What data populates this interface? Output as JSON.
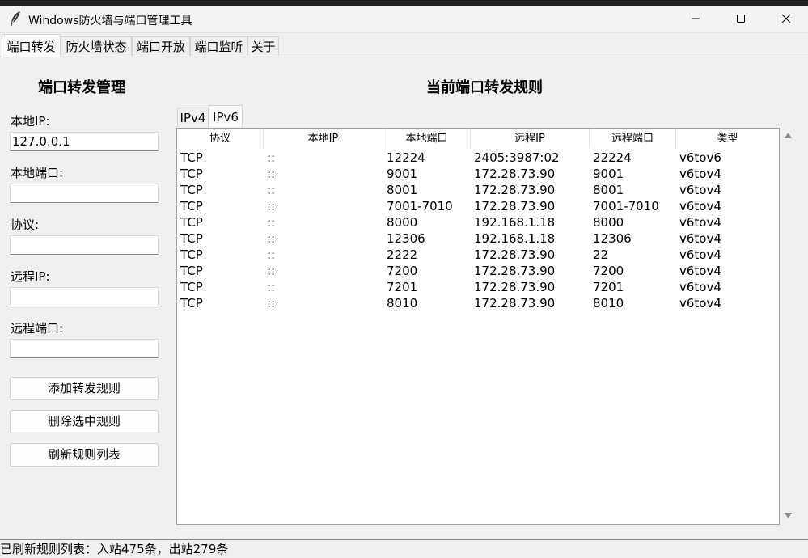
{
  "window": {
    "title": "Windows防火墙与端口管理工具"
  },
  "tabs": [
    "端口转发",
    "防火墙状态",
    "端口开放",
    "端口监听",
    "关于"
  ],
  "left": {
    "title": "端口转发管理",
    "fields": [
      {
        "label": "本地IP:",
        "value": "127.0.0.1"
      },
      {
        "label": "本地端口:",
        "value": ""
      },
      {
        "label": "协议:",
        "value": ""
      },
      {
        "label": "远程IP:",
        "value": ""
      },
      {
        "label": "远程端口:",
        "value": ""
      }
    ],
    "buttons": [
      "添加转发规则",
      "删除选中规则",
      "刷新规则列表"
    ]
  },
  "right": {
    "title": "当前端口转发规则",
    "subtabs": [
      "IPv4",
      "IPv6"
    ],
    "columns": [
      "协议",
      "本地IP",
      "本地端口",
      "远程IP",
      "远程端口",
      "类型"
    ],
    "rows": [
      [
        "TCP",
        "::",
        "12224",
        "2405:3987:02",
        "22224",
        "v6tov6"
      ],
      [
        "TCP",
        "::",
        "9001",
        "172.28.73.90",
        "9001",
        "v6tov4"
      ],
      [
        "TCP",
        "::",
        "8001",
        "172.28.73.90",
        "8001",
        "v6tov4"
      ],
      [
        "TCP",
        "::",
        "7001-7010",
        "172.28.73.90",
        "7001-7010",
        "v6tov4"
      ],
      [
        "TCP",
        "::",
        "8000",
        "192.168.1.18",
        "8000",
        "v6tov4"
      ],
      [
        "TCP",
        "::",
        "12306",
        "192.168.1.18",
        "12306",
        "v6tov4"
      ],
      [
        "TCP",
        "::",
        "2222",
        "172.28.73.90",
        "22",
        "v6tov4"
      ],
      [
        "TCP",
        "::",
        "7200",
        "172.28.73.90",
        "7200",
        "v6tov4"
      ],
      [
        "TCP",
        "::",
        "7201",
        "172.28.73.90",
        "7201",
        "v6tov4"
      ],
      [
        "TCP",
        "::",
        "8010",
        "172.28.73.90",
        "8010",
        "v6tov4"
      ]
    ]
  },
  "status": "已刷新规则列表：入站475条，出站279条"
}
